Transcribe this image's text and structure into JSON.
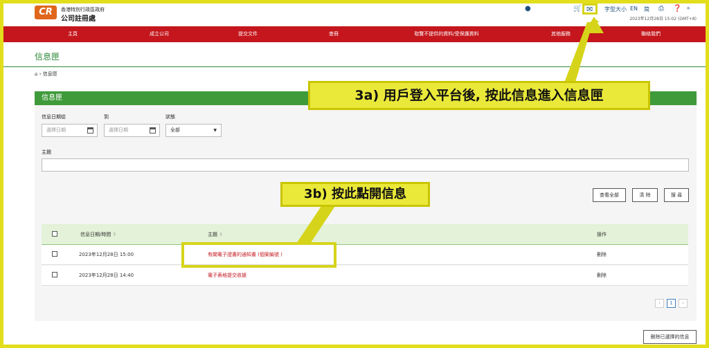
{
  "header": {
    "logo_text": "CR",
    "org_small": "香港特別行政區政府",
    "org_name": "公司註冊處",
    "font_size_label": "字型大小",
    "lang_en": "EN",
    "lang_sc": "简",
    "datetime": "2023年12月28日 15:02 (GMT+8)"
  },
  "nav": [
    "主頁",
    "成立公司",
    "提交文件",
    "查冊",
    "取覽不提供的資料/受保護資料",
    "其他服務",
    "聯絡我們"
  ],
  "page_title": "信息匣",
  "breadcrumb": "信息匣",
  "panel": {
    "heading": "信息匣",
    "date_from_label": "信息日期從",
    "date_to_label": "到",
    "status_label": "狀態",
    "date_placeholder": "選擇日期",
    "status_value": "全部",
    "subject_label": "主題",
    "buttons": {
      "view_all": "查看全部",
      "clear": "清 除",
      "search": "搜 尋"
    },
    "table": {
      "headers": [
        "信息日期/時間",
        "主題",
        "操作"
      ],
      "rows": [
        {
          "datetime": "2023年12月28日 15:00",
          "subject": "有關電子證書的通知書 (個案編號          )",
          "action": "刪除"
        },
        {
          "datetime": "2023年12月28日 14:40",
          "subject": "電子表格提交收據",
          "action": "刪除"
        }
      ]
    },
    "page_current": "1",
    "delete_selected": "刪除已選擇的信息"
  },
  "annotations": {
    "step_3a": "3a) 用戶登入平台後, 按此信息進入信息匣",
    "step_3b": "3b) 按此點開信息"
  },
  "colors": {
    "nav_red": "#c4161c",
    "panel_green": "#3f9a3a",
    "annotation_yellow": "#eae93a",
    "logo_orange": "#e0661c"
  }
}
